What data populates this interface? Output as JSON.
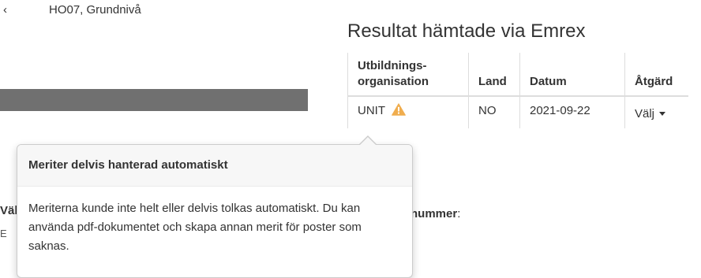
{
  "background": {
    "top_text": "HO07, Grundnivå",
    "partial_char": "‹",
    "left_label": "Välj.",
    "left_small": "E",
    "right_label": "nummer",
    "right_label_suffix": ":"
  },
  "section": {
    "title": "Resultat hämtade via Emrex"
  },
  "table": {
    "headers": {
      "org_line1": "Utbildnings-",
      "org_line2": "organisation",
      "land": "Land",
      "datum": "Datum",
      "atgard": "Åtgärd"
    },
    "rows": [
      {
        "org": "UNIT",
        "land": "NO",
        "datum": "2021-09-22",
        "action": "Välj"
      }
    ]
  },
  "popover": {
    "title": "Meriter delvis hanterad automatiskt",
    "content": "Meriterna kunde inte helt eller delvis tolkas automatiskt. Du kan använda pdf-dokumentet och skapa annan merit för poster som saknas."
  },
  "colors": {
    "warning": "#f0ad4e",
    "redaction": "#707070",
    "border": "#dddddd"
  },
  "icons": {
    "warning": "warning-triangle-icon",
    "caret": "caret-down-icon"
  }
}
